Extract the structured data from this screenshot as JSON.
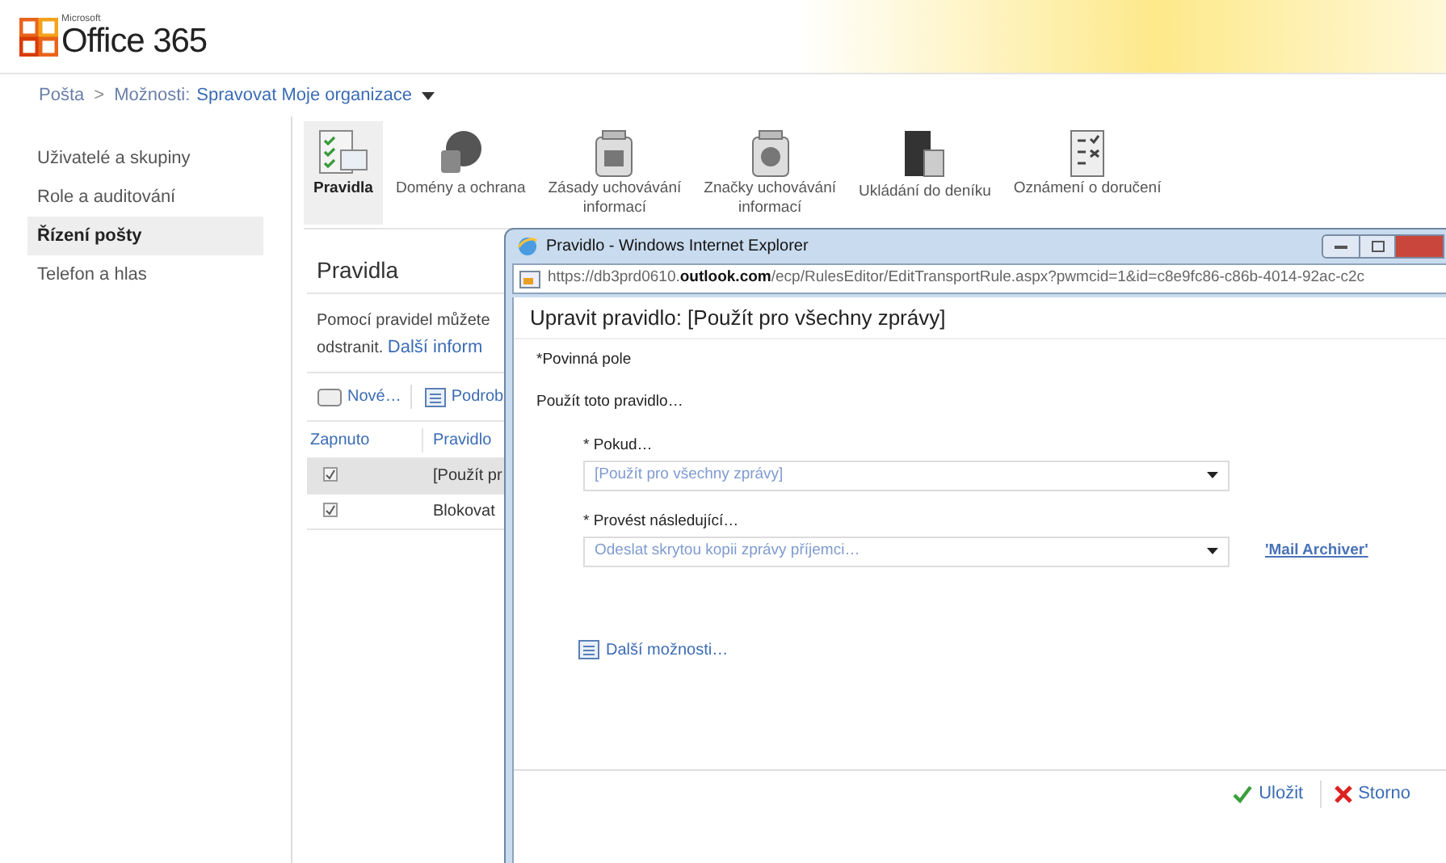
{
  "header": {
    "logo_small": "Microsoft",
    "logo": "Office 365"
  },
  "breadcrumb": {
    "items": [
      "Pošta",
      "Možnosti:"
    ],
    "separator": ">",
    "current": "Spravovat Moje organizace"
  },
  "sidebar": {
    "items": [
      {
        "label": "Uživatelé a skupiny",
        "selected": false
      },
      {
        "label": "Role a auditování",
        "selected": false
      },
      {
        "label": "Řízení pošty",
        "selected": true
      },
      {
        "label": "Telefon a hlas",
        "selected": false
      }
    ]
  },
  "toolbar": {
    "items": [
      {
        "kind": "rules",
        "lines": [
          "Pravidla"
        ],
        "selected": true
      },
      {
        "kind": "globe",
        "lines": [
          "Domény a ochrana"
        ],
        "selected": false
      },
      {
        "kind": "policy",
        "lines": [
          "Zásady uchovávání",
          "informací"
        ],
        "selected": false
      },
      {
        "kind": "tags",
        "lines": [
          "Značky uchovávání",
          "informací"
        ],
        "selected": false
      },
      {
        "kind": "journal",
        "lines": [
          "Ukládání do deníku"
        ],
        "selected": false
      },
      {
        "kind": "report",
        "lines": [
          "Oznámení o doručení"
        ],
        "selected": false
      }
    ]
  },
  "panel": {
    "title": "Pravidla",
    "description": [
      "Pomocí pravidel můžete",
      "odstranit."
    ],
    "link": "Další inform",
    "actions": [
      {
        "kind": "new",
        "label": "Nové…"
      },
      {
        "kind": "details",
        "label": "Podrob"
      }
    ],
    "table": {
      "columns": [
        "Zapnuto",
        "Pravidlo"
      ],
      "rows": [
        {
          "checked": true,
          "rule": "[Použít pr",
          "selected": true
        },
        {
          "checked": true,
          "rule": "Blokovat",
          "selected": false
        }
      ]
    }
  },
  "dialog": {
    "title": "Pravidlo - Windows Internet Explorer",
    "url": "https://db3prd0610.**outlook.com**/ecp/RulesEditor/EditTransportRule.aspx?pwmcid=1&id=c8e9fc86-c86b-4014-92ac-c2c",
    "heading": "Upravit pravidlo: [Použít pro všechny zprávy]",
    "required_note": "*Povinná pole",
    "intro": "Použít toto pravidlo…",
    "fields": [
      {
        "label": "* Pokud…",
        "value": "[Použít pro všechny zprávy]"
      },
      {
        "label": "* Provést následující…",
        "value": "Odeslat skrytou kopii zprávy příjemci…",
        "link": "'Mail Archiver'"
      }
    ],
    "more_options": "Další možnosti…",
    "buttons": [
      {
        "kind": "save",
        "label": "Uložit"
      },
      {
        "kind": "cancel",
        "label": "Storno"
      }
    ]
  }
}
